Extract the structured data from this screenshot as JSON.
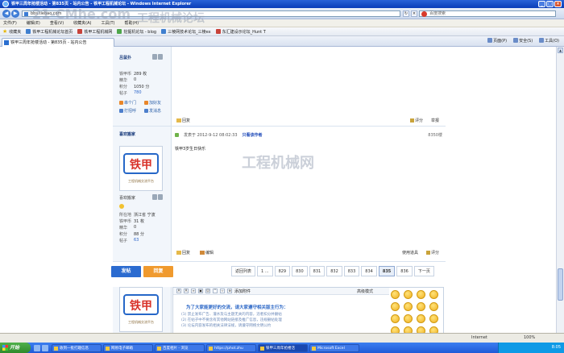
{
  "window": {
    "title": "铁甲三周年抢楼活动 - 第835页 - 站内公告 - 铁甲工程机械论坛 - Windows Internet Explorer",
    "min": "_",
    "max": "□",
    "close": "×"
  },
  "address_bar": {
    "url": "bbs.tiebao.com",
    "back": "◀",
    "forward": "▶",
    "refresh": "↻",
    "stop": "×",
    "search_placeholder": "百度搜索"
  },
  "menu": [
    "文件(F)",
    "编辑(E)",
    "查看(V)",
    "收藏夹(A)",
    "工具(T)",
    "帮助(H)"
  ],
  "favorites": {
    "label": "收藏夹",
    "items": [
      "铁甲工程机械论坛首页",
      "铁甲工程机械网",
      "挖掘机论坛 - blog",
      "三棱网技术论坛_三棱ex",
      "东汇建设示论坛_Hunt T"
    ]
  },
  "tab": {
    "label": "铁甲三周年抢楼活动 - 第835页 - 站内公告"
  },
  "commands": [
    "页面(P)",
    "安全(S)",
    "工具(O)"
  ],
  "post1": {
    "username": "吕鼠扑",
    "stats": [
      {
        "k": "铁甲币",
        "v": "289 枚"
      },
      {
        "k": "精华",
        "v": "0"
      },
      {
        "k": "积分",
        "v": "1050 分"
      },
      {
        "k": "帖子",
        "v": "780"
      }
    ],
    "links": [
      "串个门",
      "加好友",
      "打招呼",
      "发消息"
    ],
    "actions": [
      "回复"
    ],
    "right_actions": [
      "评分",
      "举报"
    ]
  },
  "post2": {
    "username": "喜欢搬家",
    "avatar_logo": "铁甲",
    "avatar_sub": "工程机械交流平台",
    "meta": "发表于 2012-9-12 08:02:33",
    "only_author": "只看该作者",
    "floor": "8350楼",
    "body": "铁甲3岁生日快乐",
    "stats": [
      {
        "k": "所在地",
        "v": "浙江省 宁波"
      },
      {
        "k": "铁甲币",
        "v": "31 枚"
      },
      {
        "k": "精华",
        "v": "0"
      },
      {
        "k": "积分",
        "v": "88 分"
      },
      {
        "k": "帖子",
        "v": "63"
      }
    ],
    "actions": [
      "回复",
      "编辑"
    ],
    "right_actions": [
      "使用道具",
      "评分"
    ],
    "username2": "喜欢搬家"
  },
  "reply_buttons": {
    "post": "发帖",
    "reply": "回复"
  },
  "pagination": [
    "返回列表",
    "1 ...",
    "829",
    "830",
    "831",
    "832",
    "833",
    "834",
    "835",
    "836",
    "下一页"
  ],
  "pagination_current": "835",
  "quick_reply": {
    "mode": "高级模式",
    "toolbar_label": "添加附件",
    "tip": "为了大家能更好的交流，请大家遵守相关版主行为：",
    "rules": [
      "(1) 禁止发布广告、灌水及与主题无关的内容，违者扣分并删帖",
      "(2) 在帖子中不要含有其他网站链接及推广信息，违规删帖处理",
      "(3) 论坛内容发布的相关法律法规，请遵守网络文明公约"
    ]
  },
  "statusbar": {
    "left": "",
    "zone": "Internet",
    "zoom": "100%"
  },
  "taskbar": {
    "start": "开始",
    "tasks": [
      "收到一批打趣信息",
      "网易电子邮箱",
      "百度相片 - 浏览",
      "https://phot.zhu",
      "铁甲三周年抢楼活",
      "Microsoft Excel"
    ],
    "active_index": 4,
    "tray_time": "8:05"
  },
  "watermarks": [
    "工程机械网",
    "21-CMhe.com",
    "工程机械论坛"
  ]
}
